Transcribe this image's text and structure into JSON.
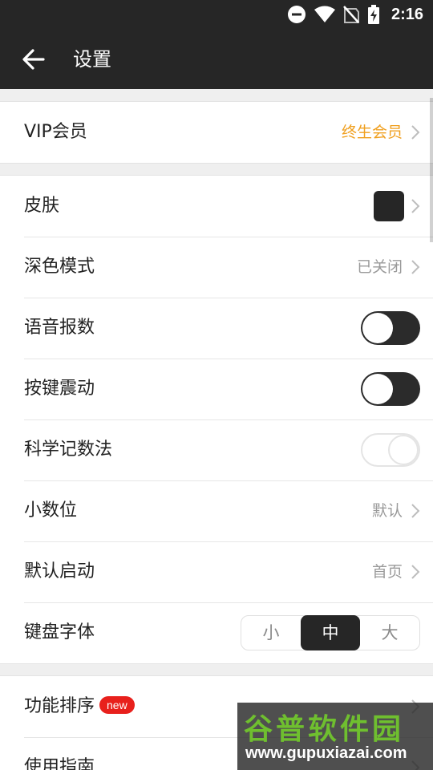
{
  "status_bar": {
    "time": "2:16",
    "icons": [
      "dnd-icon",
      "wifi-icon",
      "no-sim-icon",
      "battery-charging-icon"
    ]
  },
  "app_bar": {
    "back_icon": "arrow-left-icon",
    "title": "设置"
  },
  "vip": {
    "label": "VIP会员",
    "value": "终生会员",
    "value_color": "#f0a020"
  },
  "settings": {
    "skin": {
      "label": "皮肤",
      "swatch_color": "#262626"
    },
    "dark_mode": {
      "label": "深色模式",
      "value": "已关闭"
    },
    "voice": {
      "label": "语音报数",
      "on": false
    },
    "vibrate": {
      "label": "按键震动",
      "on": false
    },
    "scientific": {
      "label": "科学记数法",
      "on": false,
      "enabled": false
    },
    "decimal": {
      "label": "小数位",
      "value": "默认"
    },
    "startup": {
      "label": "默认启动",
      "value": "首页"
    },
    "keyboard_font": {
      "label": "键盘字体",
      "options": [
        "小",
        "中",
        "大"
      ],
      "selected": "中"
    }
  },
  "more": {
    "sort": {
      "label": "功能排序",
      "badge": "new"
    },
    "guide": {
      "label": "使用指南"
    }
  },
  "watermark": {
    "main": "谷普软件园",
    "url": "www.gupuxiazai.com"
  }
}
